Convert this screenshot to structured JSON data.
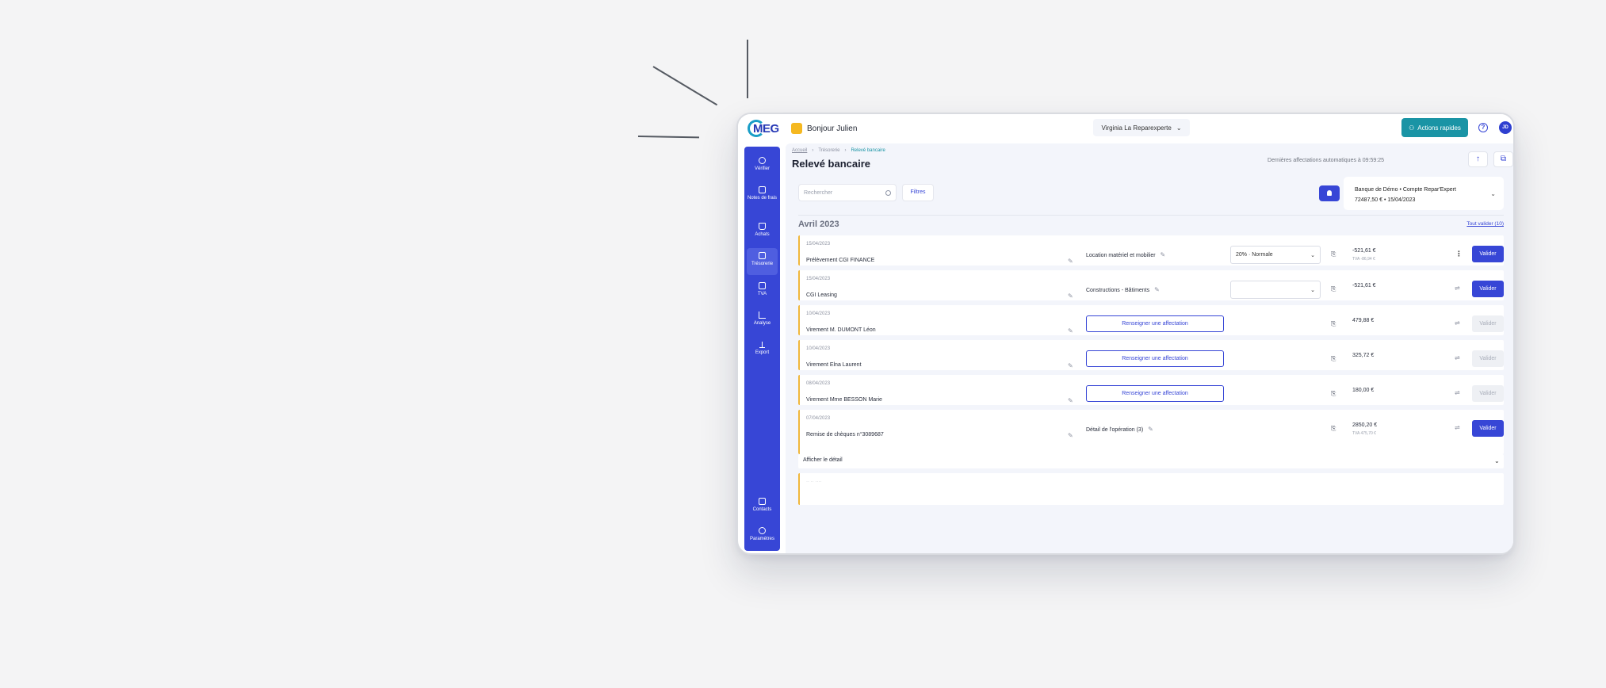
{
  "app": {
    "greeting": "Bonjour Julien",
    "company": "Virginia La Reparexperte",
    "quick_actions": "Actions rapides",
    "help": "?",
    "avatar": "JD",
    "logo": "MEG"
  },
  "sidebar": {
    "items": [
      {
        "label": "Vérifier",
        "icon": "check-circle-icon"
      },
      {
        "label": "Notes de frais",
        "icon": "receipt-icon"
      },
      {
        "label": "Achats",
        "icon": "shopping-bag-icon"
      },
      {
        "label": "Trésorerie",
        "icon": "bank-icon"
      },
      {
        "label": "TVA",
        "icon": "calculator-icon"
      },
      {
        "label": "Analyse",
        "icon": "chart-icon"
      },
      {
        "label": "Export",
        "icon": "upload-icon"
      }
    ],
    "bottom": [
      {
        "label": "Contacts",
        "icon": "contacts-icon"
      },
      {
        "label": "Paramètres",
        "icon": "settings-icon"
      }
    ]
  },
  "breadcrumb": [
    "Accueil",
    "Trésorerie",
    "Relevé bancaire"
  ],
  "page": {
    "title": "Relevé bancaire",
    "last_auto": "Dernières affectations automatiques à 09:59:25",
    "search_placeholder": "Rechercher",
    "filters": "Filtres"
  },
  "account": {
    "bank": "Banque de Démo",
    "name": "Compte Repar'Expert",
    "balance": "72487,50 €",
    "date": "15/04/2023"
  },
  "month": {
    "label": "Avril 2023",
    "validate_all": "Tout valider (10)"
  },
  "rows": [
    {
      "date": "15/04/2023",
      "label": "Prélèvement CGI FINANCE",
      "category": "Location matériel et mobilier",
      "tva": "20% · Normale",
      "amount": "-521,61 €",
      "sub": "TVA -86,94 €",
      "validate": "Valider"
    },
    {
      "date": "15/04/2023",
      "label": "CGI Leasing",
      "category": "Constructions - Bâtiments",
      "tva": "",
      "amount": "-521,61 €",
      "validate": "Valider"
    },
    {
      "date": "10/04/2023",
      "label": "Virement M. DUMONT Léon",
      "assign": "Renseigner une affectation",
      "amount": "479,88 €",
      "validate": "Valider"
    },
    {
      "date": "10/04/2023",
      "label": "Virement Elna Laurent",
      "assign": "Renseigner une affectation",
      "amount": "325,72 €",
      "validate": "Valider"
    },
    {
      "date": "08/04/2023",
      "label": "Virement Mme BESSON Marie",
      "assign": "Renseigner une affectation",
      "amount": "180,00 €",
      "validate": "Valider"
    },
    {
      "date": "07/04/2023",
      "label": "Remise de chèques n°3089687",
      "category": "Détail de l'opération (3)",
      "amount": "2850,20 €",
      "sub": "TVA 475,70 €",
      "validate": "Valider",
      "detail": "Afficher le détail"
    }
  ]
}
